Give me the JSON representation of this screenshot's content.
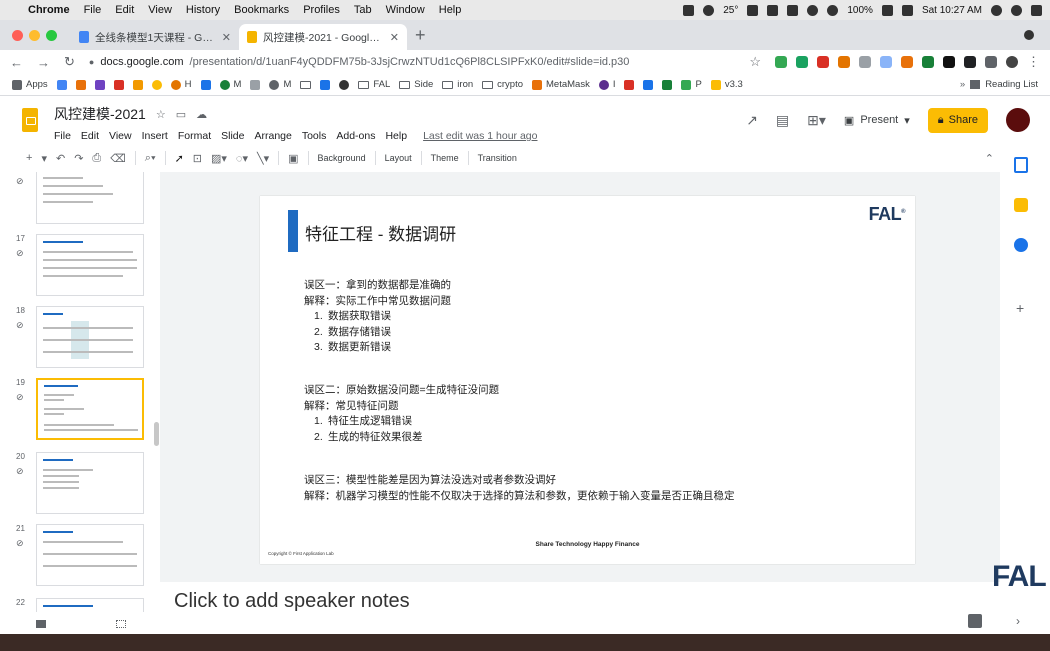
{
  "menubar": {
    "app": "Chrome",
    "items": [
      "File",
      "Edit",
      "View",
      "History",
      "Bookmarks",
      "Profiles",
      "Tab",
      "Window",
      "Help"
    ],
    "battery": "100%",
    "clock": "Sat 10:27 AM",
    "weather": "25°"
  },
  "tabs": [
    {
      "title": "全线条模型1天课程 - Google Dr",
      "favicon_color": "#4285f4"
    },
    {
      "title": "风控建模-2021 - Google Slides",
      "favicon_color": "#f4b400"
    }
  ],
  "toolbar": {
    "url_host": "docs.google.com",
    "url_path": "/presentation/d/1uanF4yQDDFM75b-3JsjCrwzNTUd1cQ6Pl8CLSIPFxK0/edit#slide=id.p30"
  },
  "bookmarks": {
    "items": [
      "Apps",
      "H",
      "M",
      "M",
      "FAL",
      "Side",
      "iron",
      "crypto",
      "MetaMask",
      "I",
      "P",
      "v3.3"
    ],
    "reading_list": "Reading List"
  },
  "doc": {
    "title": "风控建模-2021",
    "menus": [
      "File",
      "Edit",
      "View",
      "Insert",
      "Format",
      "Slide",
      "Arrange",
      "Tools",
      "Add-ons",
      "Help"
    ],
    "last_edit": "Last edit was 1 hour ago",
    "present_label": "Present",
    "share_label": "Share"
  },
  "edit_toolbar": {
    "background": "Background",
    "layout": "Layout",
    "theme": "Theme",
    "transition": "Transition"
  },
  "filmstrip": {
    "slides": [
      {
        "num": ""
      },
      {
        "num": "17"
      },
      {
        "num": "18"
      },
      {
        "num": "19"
      },
      {
        "num": "20"
      },
      {
        "num": "21"
      },
      {
        "num": "22"
      }
    ]
  },
  "slide": {
    "title": "特征工程 - 数据调研",
    "logo": "FAL",
    "section1": {
      "heading": "误区一：拿到的数据都是准确的",
      "explain": "解释：实际工作中常见数据问题",
      "items": [
        "数据获取错误",
        "数据存储错误",
        "数据更新错误"
      ]
    },
    "section2": {
      "heading": "误区二：原始数据没问题=生成特征没问题",
      "explain": "解释：常见特征问题",
      "items": [
        "特征生成逻辑错误",
        "生成的特征效果很差"
      ]
    },
    "section3": {
      "heading": "误区三：模型性能差是因为算法没选对或者参数没调好",
      "explain": "解释：机器学习模型的性能不仅取决于选择的算法和参数，更依赖于输入变量是否正确且稳定"
    },
    "footer_center": "Share Technology Happy Finance",
    "footer_left": "Copyright © First Application Lab"
  },
  "notes": {
    "placeholder": "Click to add speaker notes"
  },
  "overlay_logo": "FAL"
}
